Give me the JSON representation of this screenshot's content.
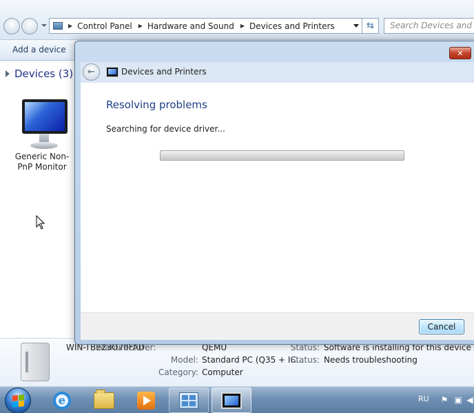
{
  "explorer": {
    "breadcrumbs": [
      "Control Panel",
      "Hardware and Sound",
      "Devices and Printers"
    ],
    "search_placeholder": "Search Devices and Printers",
    "command_bar": {
      "add_device": "Add a device"
    },
    "devices_group": {
      "title": "Devices (3)"
    },
    "device_items": [
      {
        "label": "Generic Non-PnP Monitor"
      }
    ],
    "details": {
      "computer_name": "WIN-TBE23O70FAD",
      "manufacturer_label": "Manufacturer:",
      "manufacturer_value": "QEMU",
      "model_label": "Model:",
      "model_value": "Standard PC (Q35 + IC...",
      "category_label": "Category:",
      "category_value": "Computer",
      "status_label": "Status:",
      "status_value_1": "Software is installing for this device",
      "status_value_2": "Needs troubleshooting"
    }
  },
  "dialog": {
    "close_glyph": "✕",
    "header_title": "Devices and Printers",
    "heading": "Resolving problems",
    "status_text": "Searching for device driver...",
    "progress_fraction": 0.0,
    "cancel_label": "Cancel"
  },
  "taskbar": {
    "language": "RU",
    "items": [
      "start-orb",
      "internet-explorer",
      "windows-explorer",
      "media-player",
      "control-panel",
      "devices-and-printers"
    ]
  },
  "colors": {
    "heading_blue": "#1e3d87",
    "close_red": "#c7432b",
    "taskbar_blue": "#6f8fb3"
  }
}
